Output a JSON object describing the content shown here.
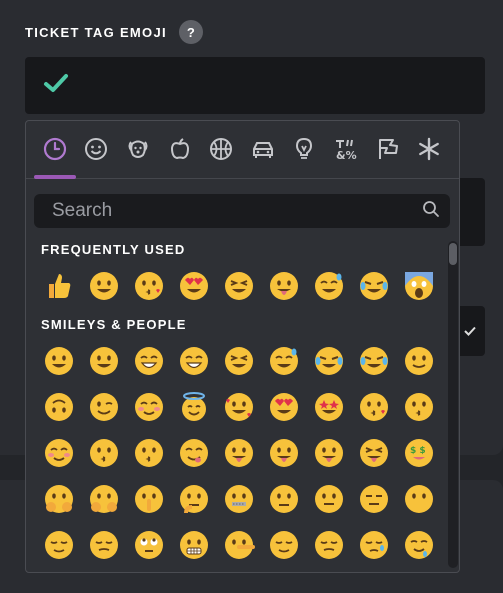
{
  "field": {
    "label": "TICKET TAG EMOJI",
    "help": "?",
    "value_icon": "green-check-icon",
    "accent": "#4ec9a7"
  },
  "picker": {
    "categories": [
      {
        "name": "recent-icon",
        "active": true
      },
      {
        "name": "smiley-icon"
      },
      {
        "name": "animal-icon"
      },
      {
        "name": "food-icon"
      },
      {
        "name": "activity-icon"
      },
      {
        "name": "travel-icon"
      },
      {
        "name": "objects-icon"
      },
      {
        "name": "symbols-icon"
      },
      {
        "name": "flags-icon"
      },
      {
        "name": "custom-icon"
      }
    ],
    "active_color": "#9b59b6",
    "search_placeholder": "Search",
    "sections": {
      "frequent": "FREQUENTLY USED",
      "smileys": "SMILEYS & PEOPLE"
    },
    "frequent": [
      "👍",
      "😀",
      "😘",
      "😍",
      "😆",
      "😜",
      "😅",
      "😂",
      "😱"
    ],
    "smileys": [
      "😀",
      "😃",
      "😄",
      "😁",
      "😆",
      "😅",
      "🤣",
      "😂",
      "🙂",
      "🙃",
      "😉",
      "😊",
      "😇",
      "🥰",
      "😍",
      "🤩",
      "😘",
      "😗",
      "☺️",
      "😚",
      "😙",
      "😋",
      "😛",
      "😜",
      "🤪",
      "😝",
      "🤑",
      "🤗",
      "🤭",
      "🤫",
      "🤔",
      "🤐",
      "🤨",
      "😐",
      "😑",
      "😶",
      "😏",
      "😒",
      "🙄",
      "😬",
      "🤥",
      "😌",
      "😔",
      "😪",
      "🤤"
    ]
  }
}
